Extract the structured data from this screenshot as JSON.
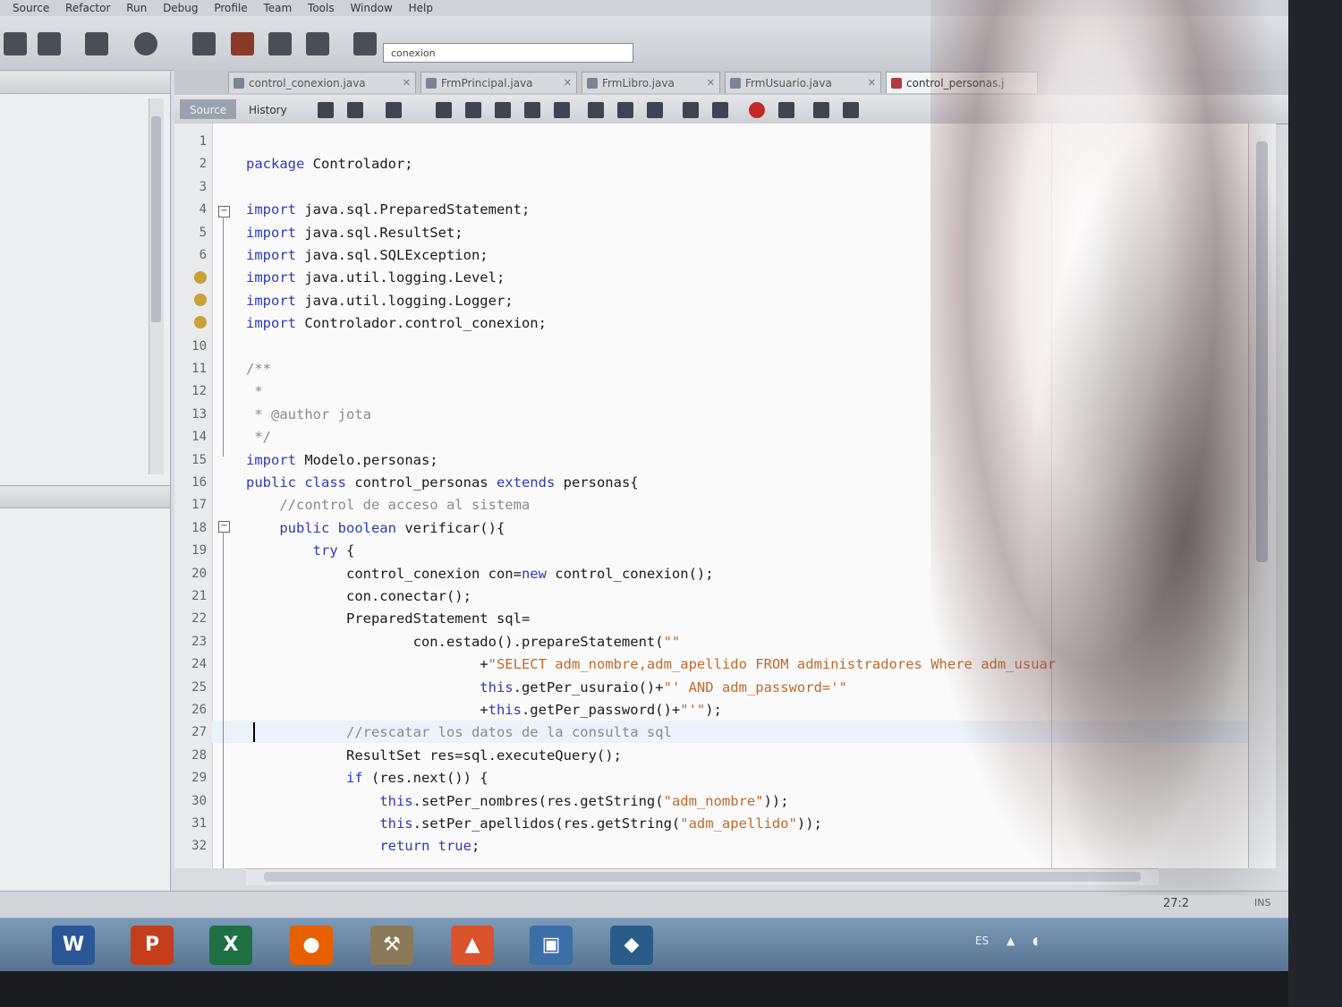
{
  "menu": [
    "Source",
    "Refactor",
    "Run",
    "Debug",
    "Profile",
    "Team",
    "Tools",
    "Window",
    "Help"
  ],
  "toolbar": {
    "config_value": "conexion"
  },
  "tabs": [
    {
      "label": "control_conexion.java",
      "active": false
    },
    {
      "label": "FrmPrincipal.java",
      "active": false
    },
    {
      "label": "FrmLibro.java",
      "active": false
    },
    {
      "label": "FrmUsuario.java",
      "active": false
    },
    {
      "label": "control_personas.j",
      "active": true
    }
  ],
  "editor_toolbar": {
    "source_label": "Source",
    "history_label": "History"
  },
  "code": [
    {
      "n": "1",
      "t": ""
    },
    {
      "n": "2",
      "t": "<span class='kw'>package</span> Controlador;"
    },
    {
      "n": "3",
      "t": ""
    },
    {
      "n": "4",
      "t": "<span class='kw'>import</span> java.sql.PreparedStatement;"
    },
    {
      "n": "5",
      "t": "<span class='kw'>import</span> java.sql.ResultSet;"
    },
    {
      "n": "6",
      "t": "<span class='kw'>import</span> java.sql.SQLException;"
    },
    {
      "n": "",
      "t": "<span class='kw'>import</span> java.util.logging.Level;"
    },
    {
      "n": "",
      "t": "<span class='kw'>import</span> java.util.logging.Logger;"
    },
    {
      "n": "",
      "t": "<span class='kw'>import</span> Controlador.control_conexion;"
    },
    {
      "n": "10",
      "t": ""
    },
    {
      "n": "11",
      "t": "<span class='cm'>/**</span>"
    },
    {
      "n": "12",
      "t": "<span class='cm'> *</span>"
    },
    {
      "n": "13",
      "t": "<span class='cm'> * @author jota</span>"
    },
    {
      "n": "14",
      "t": "<span class='cm'> */</span>"
    },
    {
      "n": "15",
      "t": "<span class='kw'>import</span> Modelo.personas;"
    },
    {
      "n": "16",
      "t": "<span class='kw'>public class</span> control_personas <span class='kw'>extends</span> personas{"
    },
    {
      "n": "17",
      "t": "    <span class='cm'>//control de acceso al sistema</span>"
    },
    {
      "n": "18",
      "t": "    <span class='kw'>public boolean</span> verificar(){"
    },
    {
      "n": "19",
      "t": "        <span class='kw'>try</span> {"
    },
    {
      "n": "20",
      "t": "            control_conexion con=<span class='kw'>new</span> control_conexion();"
    },
    {
      "n": "21",
      "t": "            con.conectar();"
    },
    {
      "n": "22",
      "t": "            PreparedStatement sql="
    },
    {
      "n": "23",
      "t": "                    con.estado().prepareStatement(<span class='str'>\"\"</span>"
    },
    {
      "n": "24",
      "t": "                            +<span class='str'>\"SELECT adm_nombre,adm_apellido FROM administradores Where adm_usuar</span>"
    },
    {
      "n": "25",
      "t": "                            <span class='kw'>this</span>.getPer_usuraio()+<span class='str'>\"' AND adm_password='\"</span>"
    },
    {
      "n": "26",
      "t": "                            +<span class='kw'>this</span>.getPer_password()+<span class='str'>\"'\"</span>);"
    },
    {
      "n": "27",
      "t": "            <span class='cm'>//rescatar los datos de la consulta sql</span>"
    },
    {
      "n": "28",
      "t": "            ResultSet res=sql.executeQuery();"
    },
    {
      "n": "29",
      "t": "            <span class='kw'>if</span> (res.next()) {"
    },
    {
      "n": "30",
      "t": "                <span class='kw'>this</span>.setPer_nombres(res.getString(<span class='str'>\"adm_nombre\"</span>));"
    },
    {
      "n": "31",
      "t": "                <span class='kw'>this</span>.setPer_apellidos(res.getString(<span class='str'>\"adm_apellido\"</span>));"
    },
    {
      "n": "32",
      "t": "                <span class='kw'>return true</span>;"
    }
  ],
  "status": {
    "caret_position": "27:2",
    "mode": "INS"
  },
  "taskbar_apps": [
    {
      "name": "word",
      "glyph": "W",
      "color": "#2b5797"
    },
    {
      "name": "powerpoint",
      "glyph": "P",
      "color": "#c43e1c"
    },
    {
      "name": "excel",
      "glyph": "X",
      "color": "#1e7145"
    },
    {
      "name": "firefox",
      "glyph": "●",
      "color": "#e66000"
    },
    {
      "name": "tools",
      "glyph": "⚒",
      "color": "#8a7a5a"
    },
    {
      "name": "matlab",
      "glyph": "▲",
      "color": "#d9532c"
    },
    {
      "name": "virtualbox",
      "glyph": "▣",
      "color": "#3c6ea8"
    },
    {
      "name": "mysql-workbench",
      "glyph": "◆",
      "color": "#2a5c8a"
    }
  ],
  "tray": {
    "lang": "ES"
  },
  "colors": {
    "keyword": "#2c3bb8",
    "string": "#c0692a",
    "comment": "#8a8a8a"
  }
}
